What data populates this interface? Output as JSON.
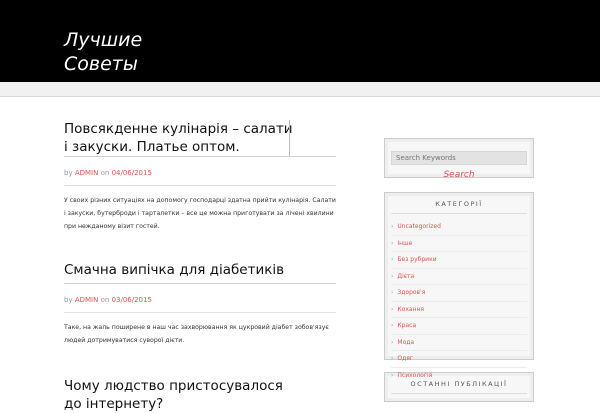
{
  "site": {
    "title": "Лучшие Советы"
  },
  "posts": [
    {
      "title": "Повсякденне кулінарія – салати і закуски. Платье оптом.",
      "author": "ADMIN",
      "on": "on",
      "by": "by",
      "date": "04/06/2015",
      "excerpt": "У своих різних ситуаціях на допомогу господарці здатна прийти кулінарія. Салати і закуски, бутерброди і тарталетки – все це можна приготувати за лічені хвилини при нежданому візит гостей."
    },
    {
      "title": "Смачна випічка для діабетиків",
      "author": "ADMIN",
      "on": "on",
      "by": "by",
      "date": "03/06/2015",
      "excerpt": "Таке, на жаль поширене в наш час захворювання як цукровий діабет зобов'язує людей дотримуватися суворої дієти."
    },
    {
      "title": "Чому людство пристосувалося до інтернету?"
    }
  ],
  "sidebar": {
    "search": {
      "placeholder": "Search Keywords",
      "button": "Search"
    },
    "categories": {
      "title": "КАТЕГОРІЇ",
      "items": [
        "Uncategorized",
        "Інше",
        "Без рубрики",
        "Дієта",
        "Здоров'я",
        "Кохання",
        "Краса",
        "Мода",
        "Одяг",
        "Психологія"
      ]
    },
    "recent": {
      "title": "ОСТАННІ ПУБЛІКАЦІЇ"
    }
  }
}
